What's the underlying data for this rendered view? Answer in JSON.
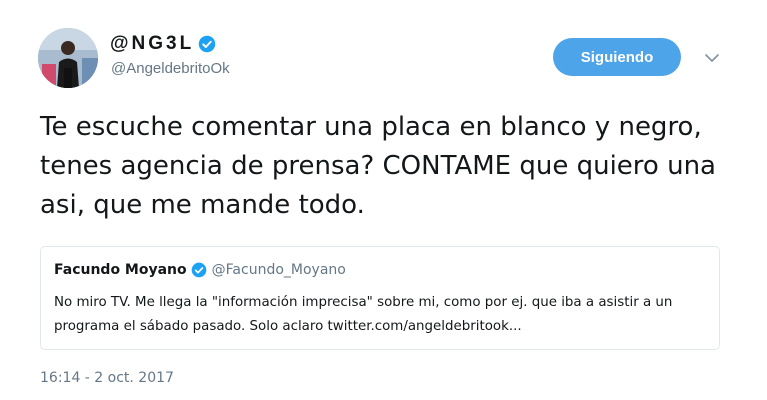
{
  "author": {
    "display_name": "@NG3L",
    "handle": "@AngeldebritoOk",
    "verified_icon": "verified-badge-icon",
    "avatar_icon": "profile-photo"
  },
  "follow_button": {
    "label": "Siguiendo"
  },
  "menu_caret_icon": "chevron-down-icon",
  "tweet": {
    "text": "Te escuche comentar una placa en blanco y negro, tenes agencia de prensa? CONTAME que quiero una asi, que me mande todo.",
    "timestamp": "16:14 - 2 oct. 2017"
  },
  "quoted_tweet": {
    "display_name": "Facundo Moyano",
    "handle": "@Facundo_Moyano",
    "text": "No miro TV. Me llega la \"información imprecisa\" sobre mi, como por ej. que iba a asistir a un programa el sábado pasado. Solo aclaro twitter.com/angeldebritook..."
  },
  "colors": {
    "accent": "#4ea4e8",
    "verified": "#1da1f2",
    "secondary_text": "#657786",
    "border": "#e1e8ed"
  }
}
